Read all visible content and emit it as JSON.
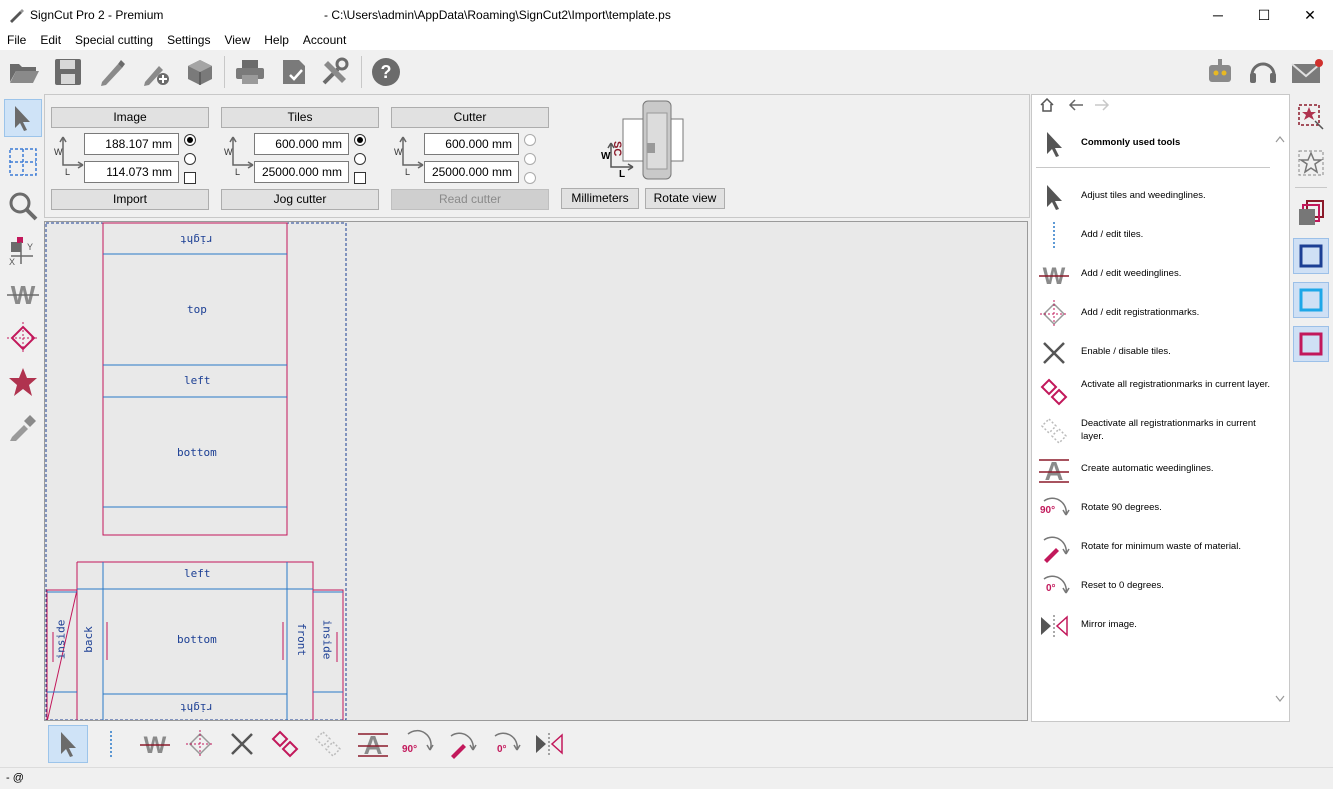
{
  "window": {
    "app_title": "SignCut Pro 2 - Premium",
    "file_path": "- C:\\Users\\admin\\AppData\\Roaming\\SignCut2\\Import\\template.ps",
    "min": "─",
    "max": "☐",
    "close": "✕"
  },
  "menu": [
    "File",
    "Edit",
    "Special cutting",
    "Settings",
    "View",
    "Help",
    "Account"
  ],
  "panel": {
    "image": {
      "title": "Image",
      "w": "188.107 mm",
      "l": "114.073 mm",
      "button": "Import"
    },
    "tiles": {
      "title": "Tiles",
      "w": "600.000 mm",
      "l": "25000.000 mm",
      "button": "Jog cutter"
    },
    "cutter": {
      "title": "Cutter",
      "w": "600.000 mm",
      "l": "25000.000 mm",
      "button": "Read cutter"
    },
    "units_button": "Millimeters",
    "rotate_button": "Rotate view",
    "axis_w": "W",
    "axis_l": "L",
    "sc_label": "SC"
  },
  "canvas": {
    "labels": {
      "right_top": "right",
      "top": "top",
      "left1": "left",
      "bottom1": "bottom",
      "left2": "left",
      "bottom2": "bottom",
      "right_bottom": "right",
      "inside_left": "inside",
      "back": "back",
      "front": "front",
      "inside_right": "inside"
    }
  },
  "right_panel": {
    "header": "Commonly used tools",
    "items": [
      {
        "label": "Adjust tiles and weedinglines.",
        "icon": "arrow-pointer-icon"
      },
      {
        "label": "Add / edit tiles.",
        "icon": "tile-line-icon"
      },
      {
        "label": "Add / edit weedinglines.",
        "icon": "weedline-w-icon"
      },
      {
        "label": "Add / edit registrationmarks.",
        "icon": "registration-mark-icon"
      },
      {
        "label": "Enable / disable tiles.",
        "icon": "cross-icon"
      },
      {
        "label": "Activate all registrationmarks in current layer.",
        "icon": "activate-regmarks-icon"
      },
      {
        "label": "Deactivate all registrationmarks in current layer.",
        "icon": "deactivate-regmarks-icon"
      },
      {
        "label": "Create automatic weedinglines.",
        "icon": "auto-weedline-icon"
      },
      {
        "label": "Rotate 90 degrees.",
        "icon": "rotate-90-icon"
      },
      {
        "label": "Rotate for minimum waste of material.",
        "icon": "rotate-min-waste-icon"
      },
      {
        "label": "Reset to 0 degrees.",
        "icon": "reset-0-icon"
      },
      {
        "label": "Mirror image.",
        "icon": "mirror-icon"
      }
    ],
    "deg90": "90°",
    "deg0": "0°"
  },
  "status": {
    "text": "- @"
  },
  "colors": {
    "accent_blue": "#1c3f94",
    "magenta": "#c2185b",
    "tile_blue": "#2979c7"
  }
}
